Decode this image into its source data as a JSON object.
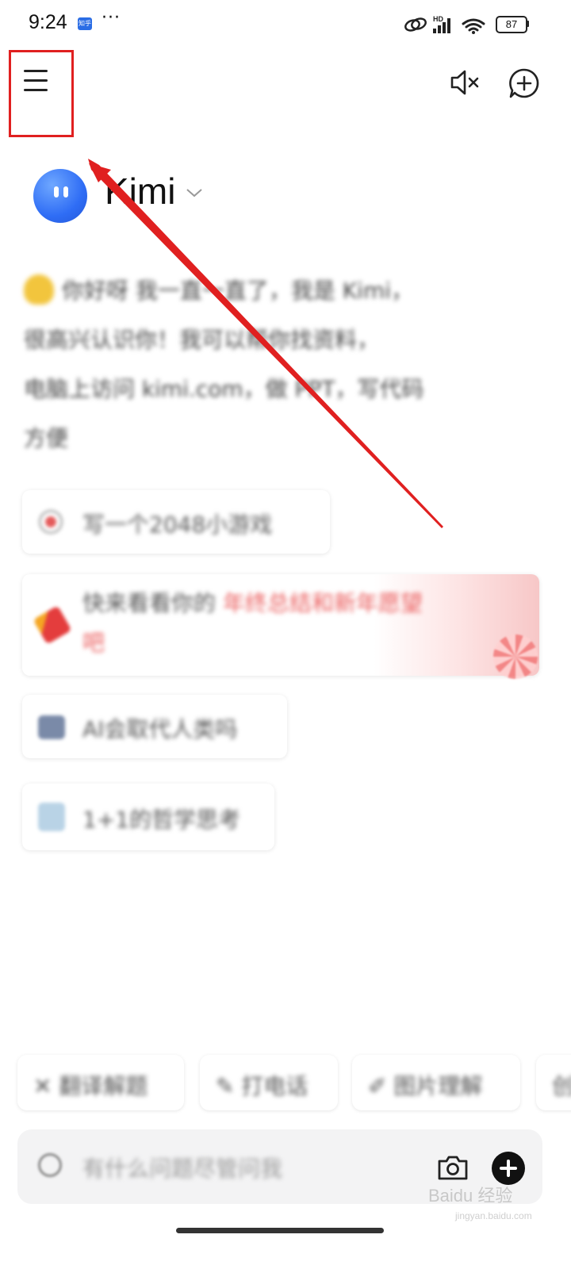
{
  "status_bar": {
    "time": "9:24",
    "app_badge": "知乎",
    "more": "···",
    "battery": "87",
    "network": "HD"
  },
  "header": {
    "menu_icon": "hamburger-menu-icon",
    "mute_icon": "speaker-muted-icon",
    "new_chat_icon": "new-chat-icon"
  },
  "brand": {
    "name": "Kimi"
  },
  "greeting": {
    "line1": "你好呀 我一直一直了，我是 Kimi，",
    "line2": "很高兴认识你！我可以帮你找资料，",
    "line3": "电脑上访问 kimi.com，做 PPT，写代码",
    "line4": "方便"
  },
  "suggestions": [
    {
      "icon": "target-icon",
      "text": "写一个2048小游戏"
    },
    {
      "icon": "firecracker-icon",
      "text": "快来看看你的",
      "highlight": "年终总结和新年愿望",
      "extra": "吧"
    },
    {
      "icon": "robot-icon",
      "text": "AI会取代人类吗"
    },
    {
      "icon": "image-icon",
      "text": "1+1的哲学思考"
    }
  ],
  "chips": [
    {
      "icon": "chip-icon",
      "label": "✕ 翻译解题"
    },
    {
      "icon": "phone-icon",
      "label": "✎ 打电话"
    },
    {
      "icon": "edit-icon",
      "label": "✐ 图片理解"
    },
    {
      "icon": "more-icon",
      "label": "创"
    }
  ],
  "input": {
    "placeholder": "有什么问题尽管问我",
    "camera_icon": "camera-icon",
    "plus_icon": "plus-icon"
  },
  "watermark": {
    "text": "Baidu 经验",
    "sub": "jingyan.baidu.com"
  },
  "colors": {
    "annotation_red": "#e02020",
    "brand_blue": "#2f6df5",
    "accent_pink": "#ea5b5b"
  }
}
